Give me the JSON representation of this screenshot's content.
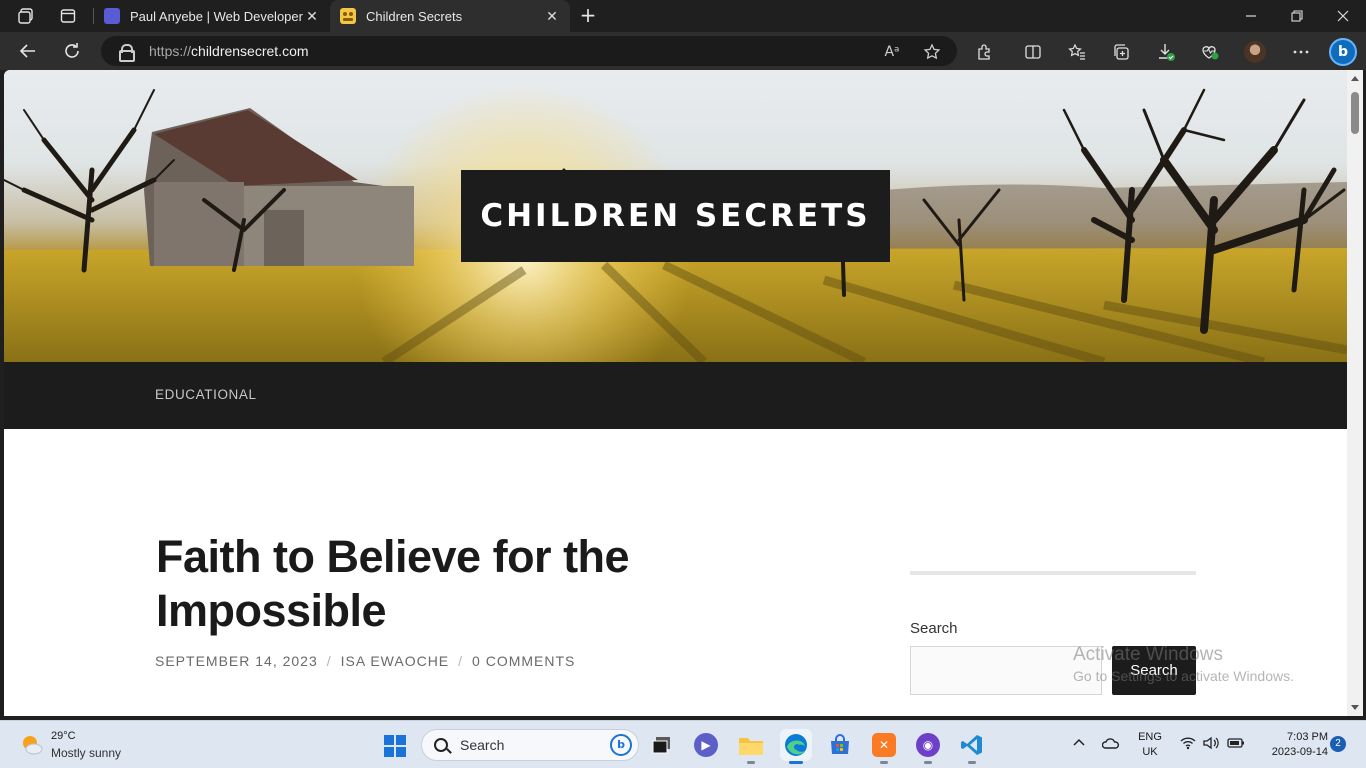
{
  "browser": {
    "tabs": [
      {
        "title": "Paul Anyebe | Web Developer",
        "active": false,
        "favicon_color": "#5b5bd6"
      },
      {
        "title": "Children Secrets",
        "active": true,
        "favicon_color": "#f2c744"
      }
    ],
    "url": {
      "protocol": "https://",
      "host": "childrensecret.com"
    },
    "read_aloud_label": "Aᵃ",
    "accent": "#0f6cbd"
  },
  "site": {
    "title": "CHILDREN SECRETS",
    "menu": [
      "EDUCATIONAL"
    ]
  },
  "post": {
    "title": "Faith to Believe for the Impossible",
    "date": "SEPTEMBER 14, 2023",
    "author": "ISA EWAOCHE",
    "comments": "0 COMMENTS",
    "separator": "/"
  },
  "sidebar": {
    "search_label": "Search",
    "search_button": "Search",
    "search_value": ""
  },
  "watermark": {
    "title": "Activate Windows",
    "subtitle": "Go to Settings to activate Windows."
  },
  "taskbar": {
    "weather_temp": "29°C",
    "weather_desc": "Mostly sunny",
    "search_placeholder": "Search",
    "lang_top": "ENG",
    "lang_bottom": "UK",
    "time": "7:03 PM",
    "date": "2023-09-14",
    "notification_count": "2"
  }
}
